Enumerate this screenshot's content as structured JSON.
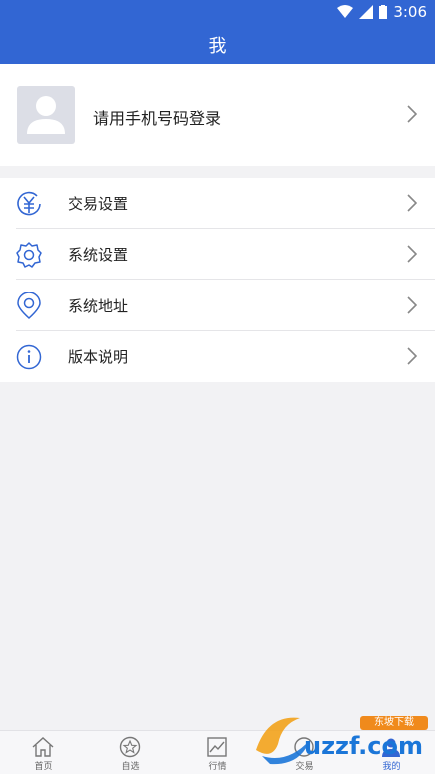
{
  "status_bar": {
    "time": "3:06"
  },
  "header": {
    "title": "我"
  },
  "profile": {
    "login_prompt": "请用手机号码登录"
  },
  "menu": [
    {
      "label": "交易设置",
      "icon": "yuan-icon"
    },
    {
      "label": "系统设置",
      "icon": "gear-icon"
    },
    {
      "label": "系统地址",
      "icon": "location-pin-icon"
    },
    {
      "label": "版本说明",
      "icon": "info-icon"
    }
  ],
  "tabs": [
    {
      "label": "首页",
      "icon": "home-icon"
    },
    {
      "label": "自选",
      "icon": "star-icon"
    },
    {
      "label": "行情",
      "icon": "chart-icon"
    },
    {
      "label": "交易",
      "icon": "trade-icon"
    },
    {
      "label": "我的",
      "icon": "person-icon",
      "active": true
    }
  ],
  "watermark": {
    "text": "uzzf.com",
    "tag": "东坡下载"
  },
  "colors": {
    "brand": "#3266d3",
    "background": "#f2f2f4"
  }
}
